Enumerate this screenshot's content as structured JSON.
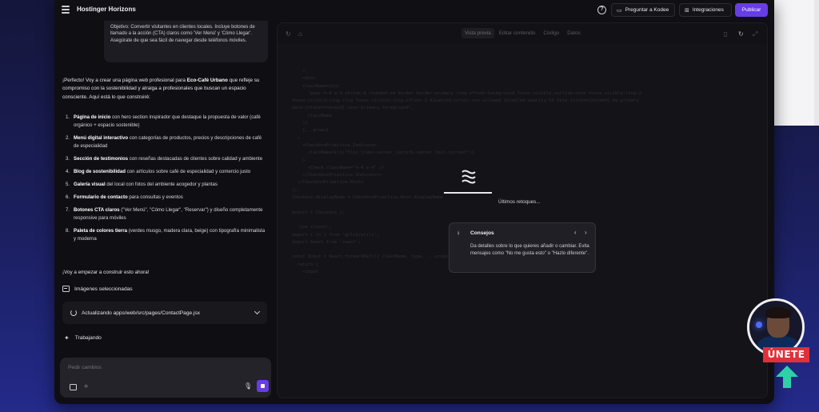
{
  "app": {
    "brand": "Hostinger Horizons",
    "ask_kodee": "Preguntar a Kodee",
    "integrations": "Integraciones",
    "publish": "Publicar"
  },
  "chat": {
    "user_message": "Objetivo: Convertir visitantes en clientes locales. Incluye botones de llamado a la acción (CTA) claros como 'Ver Menú' y 'Cómo Llegar'. Asegúrate de que sea fácil de navegar desde teléfonos móviles.",
    "intro_a": "¡Perfecto! Voy a crear una página web profesional para ",
    "intro_brand": "Eco-Café Urbano",
    "intro_b": " que refleje su compromiso con la sostenibilidad y atraiga a profesionales que buscan un espacio consciente. Aquí está lo que construiré:",
    "features": [
      {
        "num": "1.",
        "bold": "Página de inicio",
        "text": " con hero section inspirador que destaque la propuesta de valor (café orgánico + espacio sostenible)"
      },
      {
        "num": "2.",
        "bold": "Menú digital interactivo",
        "text": " con categorías de productos, precios y descripciones de café de especialidad"
      },
      {
        "num": "3.",
        "bold": "Sección de testimonios",
        "text": " con reseñas destacadas de clientes sobre calidad y ambiente"
      },
      {
        "num": "4.",
        "bold": "Blog de sostenibilidad",
        "text": " con artículos sobre café de especialidad y comercio justo"
      },
      {
        "num": "5.",
        "bold": "Galería visual",
        "text": " del local con fotos del ambiente acogedor y plantas"
      },
      {
        "num": "6.",
        "bold": "Formulario de contacto",
        "text": " para consultas y eventos"
      },
      {
        "num": "7.",
        "bold": "Botones CTA claros",
        "text": " (\"Ver Menú\", \"Cómo Llegar\", \"Reservar\") y diseño completamente responsive para móviles"
      },
      {
        "num": "8.",
        "bold": "Paleta de colores tierra",
        "text": " (verdes musgo, madera clara, beige) con tipografía minimalista y moderna"
      }
    ],
    "outro": "¡Voy a empezar a construir esto ahora!",
    "selected_images": "Imágenes seleccionadas",
    "status": "Actualizando apps/web/src/pages/ContactPage.jsx",
    "working": "Trabajando",
    "input_placeholder": "Pedir cambios"
  },
  "preview": {
    "tabs": [
      "Vista previa",
      "Editar contenido",
      "Código",
      "Datos"
    ],
    "active_tab": "Vista previa",
    "code_lines": [
      "    >",
      "    <div>",
      "    className={cn(",
      "      \"peer h-4 w-4 shrink-0 rounded-sm border border-primary ring-offset-background focus-visible:outline-none focus-visible:ring-2",
      "focus-visible:ring-ring focus-visible:ring-offset-2 disabled:cursor-not-allowed disabled:opacity-50 data-[state=checked]:bg-primary",
      "data-[state=checked]:text-primary-foreground\",",
      "      className",
      "    )}",
      "    {...props}",
      "  >",
      "    <CheckboxPrimitive.Indicator",
      "      className={cn(\"flex items-center justify-center text-current\")}",
      "    >",
      "      <Check className=\"h-4 w-4\" />",
      "    </CheckboxPrimitive.Indicator>",
      "  </CheckboxPrimitive.Root>",
      "));",
      "Checkbox.displayName = CheckboxPrimitive.Root.displayName",
      "",
      "export { Checkbox };",
      "",
      "  'use client';",
      "import { cn } from '@/lib/utils';",
      "import React from 'react';",
      "",
      "const Input = React.forwardRef(({ className, type, ...props }, ref) => {",
      "  return (",
      "    <input"
    ],
    "loading_text": "Últimos retoques...",
    "loading_progress": 1.0
  },
  "tips": {
    "title": "Consejos",
    "text": "Da detalles sobre lo que quieres añadir o cambiar. Evita mensajes como \"No me gusta esto\" o \"Hazlo diferente\"."
  },
  "overlay": {
    "join": "ÚNETE"
  }
}
